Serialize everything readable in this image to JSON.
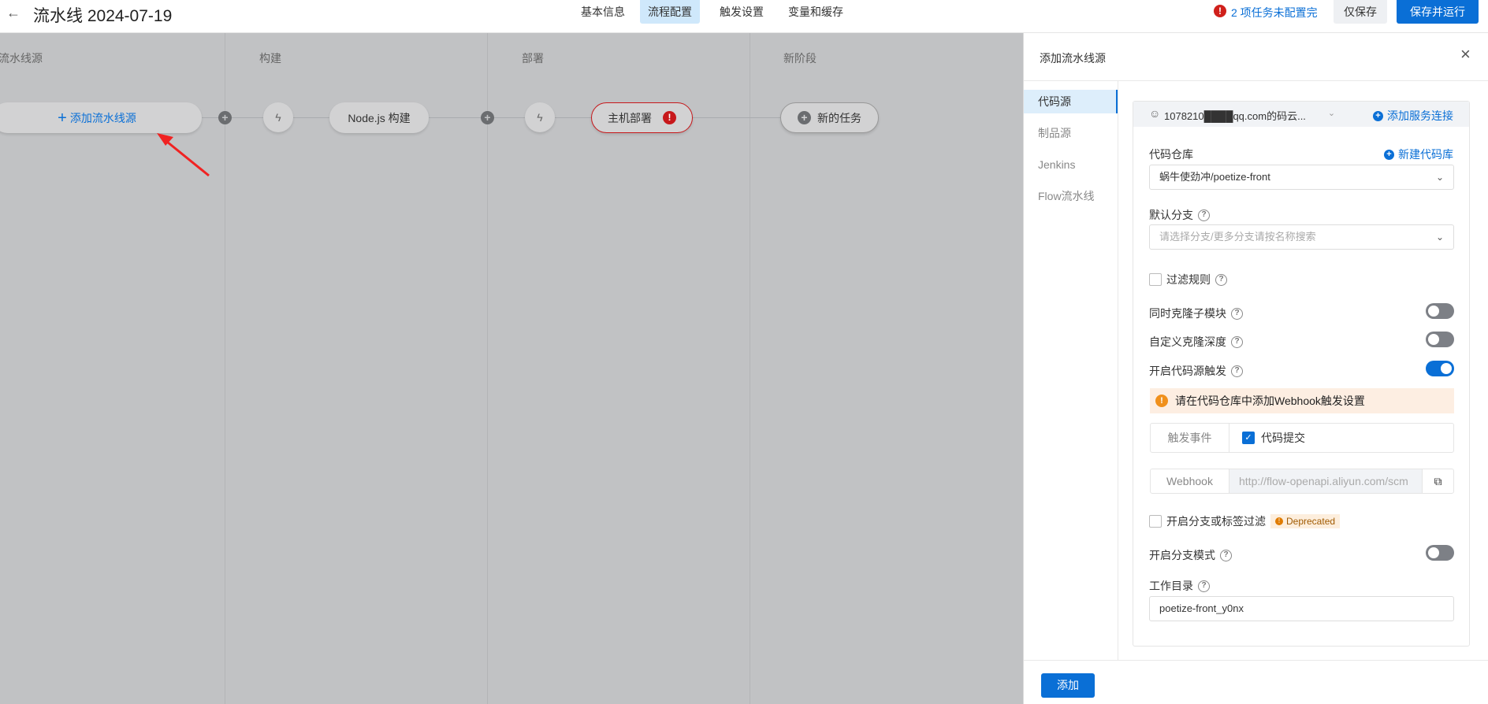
{
  "header": {
    "title": "流水线 2024-07-19",
    "tabs": [
      "基本信息",
      "流程配置",
      "触发设置",
      "变量和缓存"
    ],
    "active_tab": "流程配置",
    "warning": "2 项任务未配置完",
    "save_only": "仅保存",
    "save_run": "保存并运行"
  },
  "canvas": {
    "stages": [
      "流水线源",
      "构建",
      "部署",
      "新阶段"
    ],
    "add_source": "添加流水线源",
    "build_job": "Node.js 构建",
    "deploy_job": "主机部署",
    "new_task": "新的任务"
  },
  "panel": {
    "title": "添加流水线源",
    "nav": [
      "代码源",
      "制品源",
      "Jenkins",
      "Flow流水线"
    ],
    "active_nav": "代码源",
    "account": "1078210████qq.com的码云...",
    "add_connection": "添加服务连接",
    "repo_label": "代码仓库",
    "new_repo": "新建代码库",
    "repo_value": "蜗牛使劲冲/poetize-front",
    "branch_label": "默认分支",
    "branch_placeholder": "请选择分支/更多分支请按名称搜索",
    "filter_rules": "过滤规则",
    "clone_submodules": "同时克隆子模块",
    "clone_depth": "自定义克隆深度",
    "enable_trigger": "开启代码源触发",
    "toggles": {
      "clone_submodules": false,
      "clone_depth": false,
      "enable_trigger": true,
      "branch_mode": false
    },
    "alert": "请在代码仓库中添加Webhook触发设置",
    "trigger_event_label": "触发事件",
    "trigger_event_value": "代码提交",
    "webhook_label": "Webhook",
    "webhook_value": "http://flow-openapi.aliyun.com/scm",
    "branch_tag_filter": "开启分支或标签过滤",
    "deprecated": "Deprecated",
    "branch_mode": "开启分支模式",
    "workdir_label": "工作目录",
    "workdir_value": "poetize-front_y0nx",
    "add_button": "添加"
  },
  "colors": {
    "primary": "#0a6fd6",
    "error": "#d0201b",
    "warning": "#f0901c"
  }
}
